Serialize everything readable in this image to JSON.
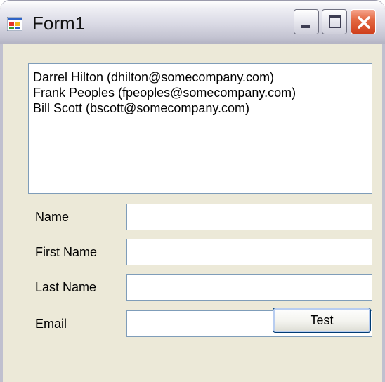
{
  "window": {
    "title": "Form1",
    "icon": "form-app-icon",
    "buttons": {
      "minimize": "minimize-icon",
      "maximize": "maximize-icon",
      "close": "close-icon"
    }
  },
  "list": {
    "items": [
      "Darrel Hilton (dhilton@somecompany.com)",
      "Frank Peoples (fpeoples@somecompany.com)",
      "Bill Scott (bscott@somecompany.com)"
    ]
  },
  "fields": [
    {
      "label": "Name",
      "value": ""
    },
    {
      "label": "First Name",
      "value": ""
    },
    {
      "label": "Last Name",
      "value": ""
    },
    {
      "label": "Email",
      "value": ""
    }
  ],
  "actions": {
    "test_label": "Test"
  },
  "colors": {
    "face": "#ece9d8",
    "input_border": "#7f9db9",
    "close_button": "#e46a44"
  }
}
